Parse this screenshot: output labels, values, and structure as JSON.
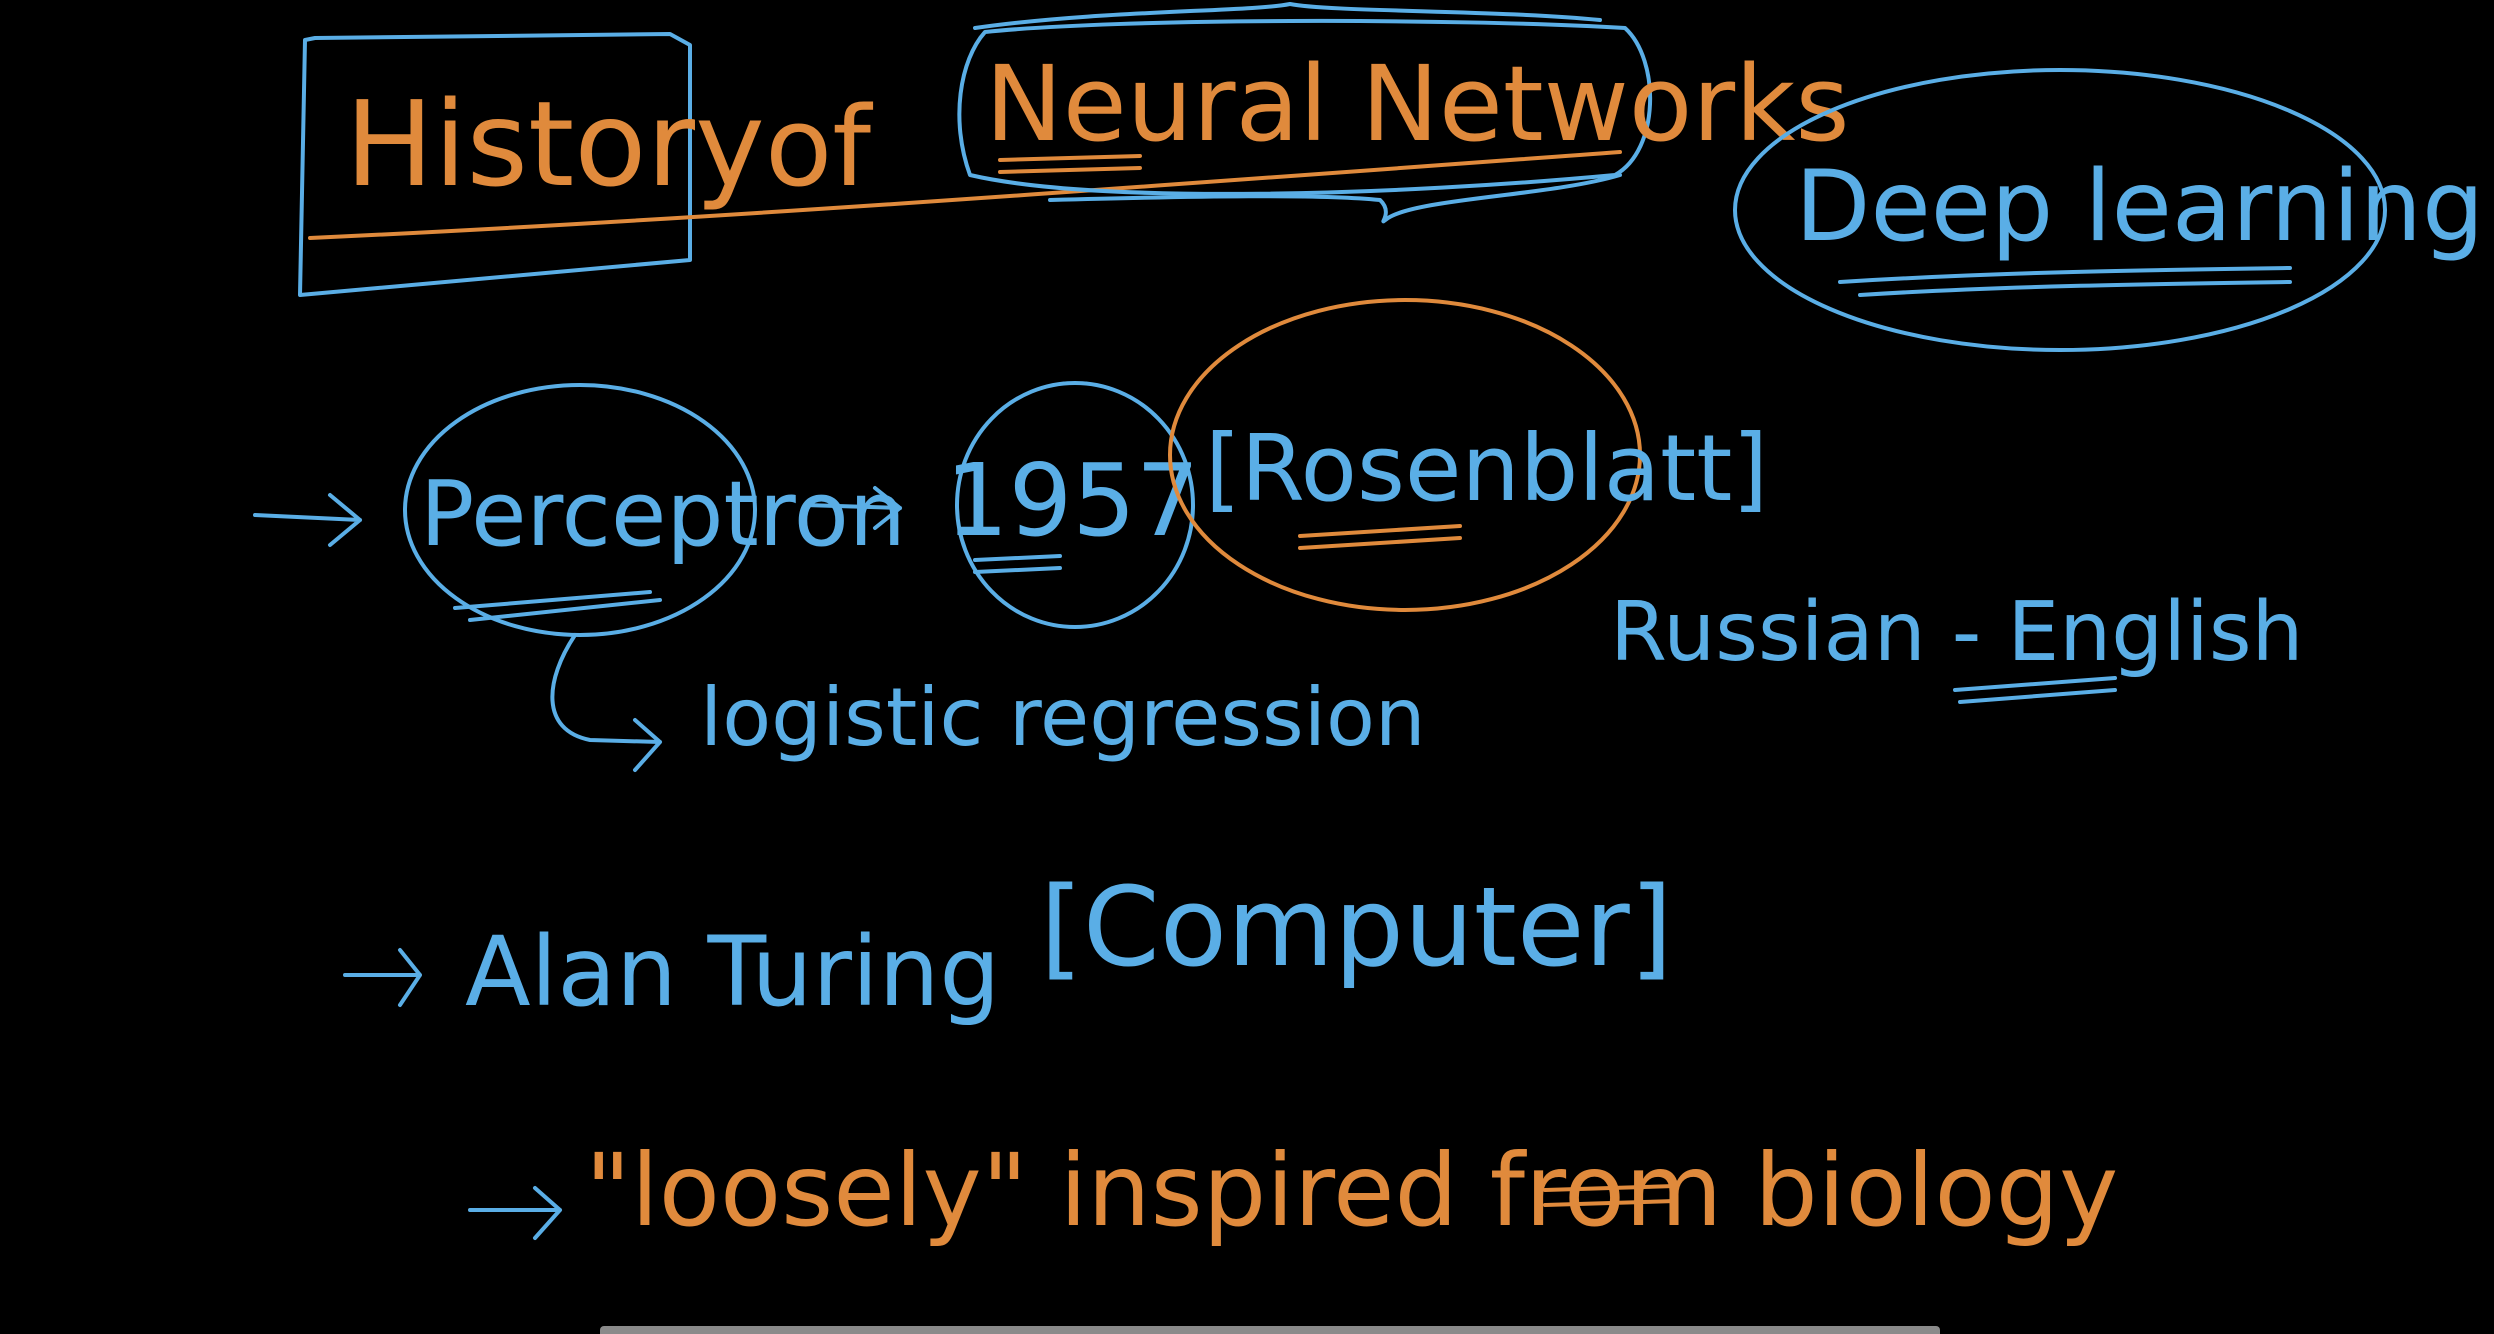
{
  "colors": {
    "background": "#000000",
    "blue_ink": "#5aaee6",
    "orange_ink": "#e08a3c"
  },
  "notes": {
    "title_history": "History",
    "title_of": "of",
    "title_neural_networks": "Neural Networks",
    "deep_learning": "Deep learning",
    "perceptron": "Perceptron",
    "year": "1957",
    "rosenblatt": "[Rosenblatt]",
    "russian_english": "Russian - English",
    "logistic_regression": "logistic regression",
    "alan_turing": "Alan Turing",
    "computer": "[Computer]",
    "loosely_inspired": "\"loosely\" inspired from biology"
  }
}
